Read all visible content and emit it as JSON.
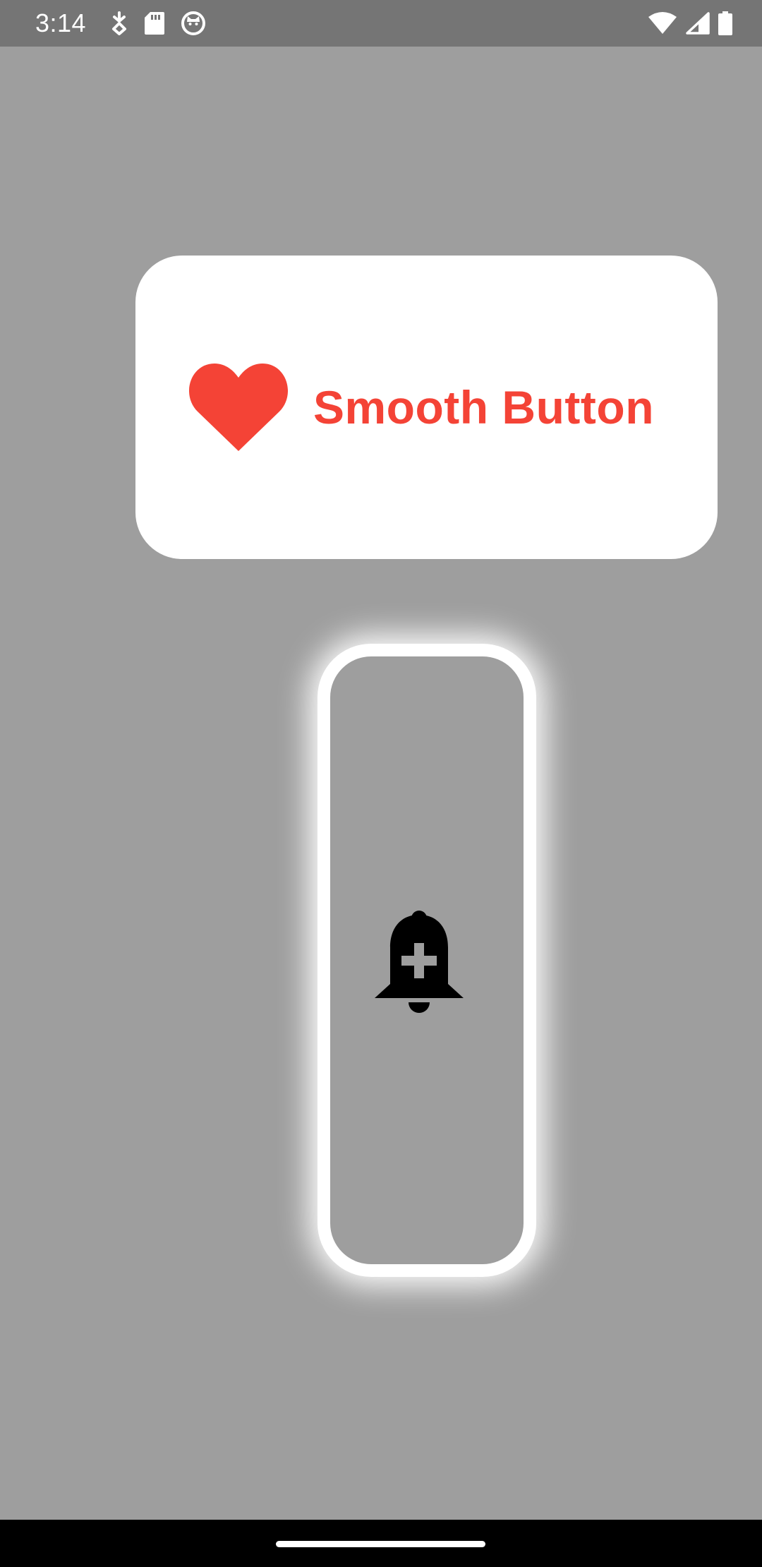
{
  "status_bar": {
    "time": "3:14",
    "left_icons": [
      "sync-icon",
      "sd-card-icon",
      "cat-face-icon"
    ],
    "right_icons": [
      "wifi-icon",
      "cell-signal-icon",
      "battery-icon"
    ]
  },
  "smooth_button": {
    "label": "Smooth Button",
    "icon": "heart-icon",
    "accent_color": "#f44336",
    "background_color": "#ffffff"
  },
  "bell_button": {
    "icon": "bell-plus-icon",
    "glow_color": "#ffffff",
    "fill_color": "#9e9e9e"
  },
  "colors": {
    "screen_background": "#9e9e9e",
    "status_bar_background": "#757575",
    "nav_bar_background": "#000000"
  }
}
